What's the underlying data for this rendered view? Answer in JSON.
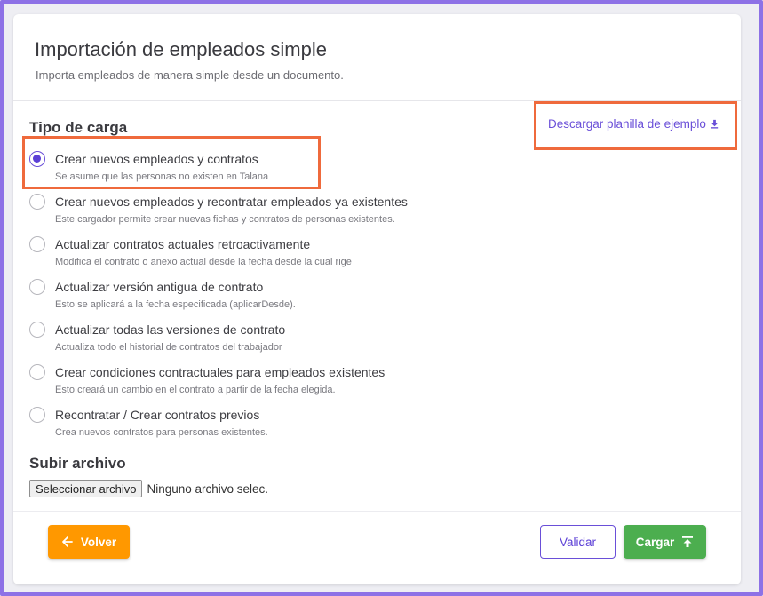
{
  "header": {
    "title": "Importación de empleados simple",
    "subtitle": "Importa empleados de manera simple desde un documento."
  },
  "load_type": {
    "title": "Tipo de carga",
    "download_link": "Descargar planilla de ejemplo",
    "options": [
      {
        "label": "Crear nuevos empleados y contratos",
        "description": "Se asume que las personas no existen en Talana",
        "checked": true
      },
      {
        "label": "Crear nuevos empleados y recontratar empleados ya existentes",
        "description": "Este cargador permite crear nuevas fichas y contratos de personas existentes.",
        "checked": false
      },
      {
        "label": "Actualizar contratos actuales retroactivamente",
        "description": "Modifica el contrato o anexo actual desde la fecha desde la cual rige",
        "checked": false
      },
      {
        "label": "Actualizar versión antigua de contrato",
        "description": "Esto se aplicará a la fecha especificada (aplicarDesde).",
        "checked": false
      },
      {
        "label": "Actualizar todas las versiones de contrato",
        "description": "Actualiza todo el historial de contratos del trabajador",
        "checked": false
      },
      {
        "label": "Crear condiciones contractuales para empleados existentes",
        "description": "Esto creará un cambio en el contrato a partir de la fecha elegida.",
        "checked": false
      },
      {
        "label": "Recontratar / Crear contratos previos",
        "description": "Crea nuevos contratos para personas existentes.",
        "checked": false
      }
    ]
  },
  "upload": {
    "title": "Subir archivo",
    "button_label": "Seleccionar archivo",
    "status": "Ninguno archivo selec."
  },
  "footer": {
    "back_label": "Volver",
    "validate_label": "Validar",
    "upload_label": "Cargar"
  },
  "colors": {
    "accent": "#5b3fd6",
    "back": "#ff9800",
    "upload": "#4cae4f",
    "highlight": "#ef6a3c"
  }
}
